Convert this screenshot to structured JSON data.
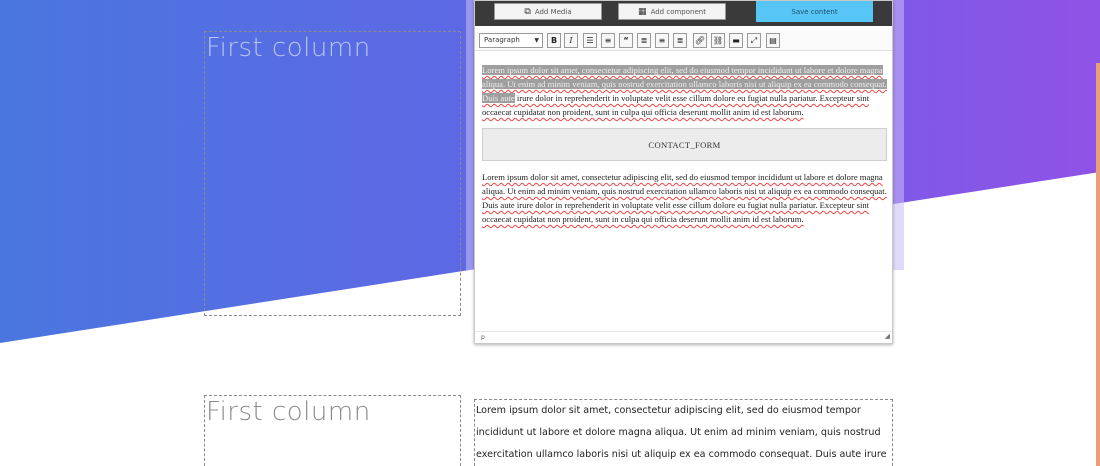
{
  "section1": {
    "column_title": "First column"
  },
  "editor": {
    "buttons": {
      "add_media": "Add Media",
      "add_component": "Add component",
      "save": "Save content"
    },
    "format_select": "Paragraph",
    "toolbar_icons": [
      "bold-icon",
      "italic-icon",
      "bullet-list-icon",
      "numbered-list-icon",
      "blockquote-icon",
      "align-left-icon",
      "align-center-icon",
      "align-right-icon",
      "link-icon",
      "unlink-icon",
      "horizontal-rule-icon",
      "fullscreen-icon",
      "kitchen-sink-icon"
    ],
    "paragraph1_selected": "Lorem ipsum dolor sit amet, consectetur adipiscing elit, sed do eiusmod tempor incididunt ut labore et dolore magna aliqua. Ut enim ad minim veniam, quis nostrud exercitation ullamco laboris nisi ut aliquip ex ea commodo consequat. Duis aute",
    "paragraph1_rest": " irure dolor in reprehenderit in voluptate velit esse cillum dolore eu fugiat nulla pariatur. Excepteur sint occaecat cupidatat non proident, sunt in culpa qui officia deserunt mollit anim id est laborum.",
    "contact_form": "CONTACT_FORM",
    "paragraph2": "Lorem ipsum dolor sit amet, consectetur adipiscing elit, sed do eiusmod tempor incididunt ut labore et dolore magna aliqua. Ut enim ad minim veniam, quis nostrud exercitation ullamco laboris nisi ut aliquip ex ea commodo consequat. Duis aute irure dolor in reprehenderit in voluptate velit esse cillum dolore eu fugiat nulla pariatur. Excepteur sint occaecat cupidatat non proident, sunt in culpa qui officia deserunt mollit anim id est laborum.",
    "status_path": "p"
  },
  "section2": {
    "column_title": "First column",
    "text": "Lorem ipsum dolor sit amet, consectetur adipiscing elit, sed do eiusmod tempor incididunt ut labore et dolore magna aliqua. Ut enim ad minim veniam, quis nostrud exercitation ullamco laboris nisi ut aliquip ex ea commodo consequat. Duis aute irure"
  },
  "colors": {
    "gradient_start": "#4a76e0",
    "gradient_end": "#8f53e6",
    "save_button": "#57c6f6",
    "accent_line": "#e9a07a"
  }
}
